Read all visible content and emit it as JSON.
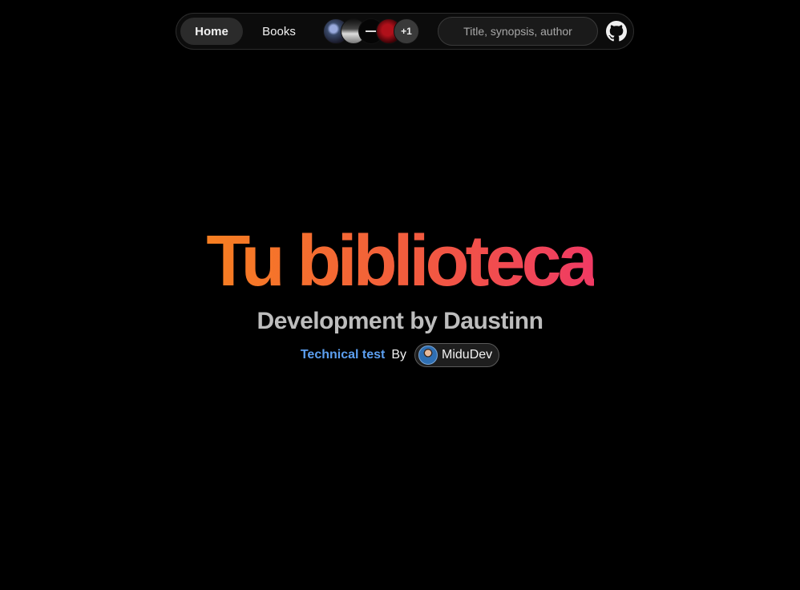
{
  "nav": {
    "home_label": "Home",
    "books_label": "Books",
    "covers": [
      {
        "icon": "book-cover-1"
      },
      {
        "icon": "book-cover-2"
      },
      {
        "icon": "book-cover-3"
      },
      {
        "icon": "book-cover-4"
      }
    ],
    "more_count": "+1",
    "search_placeholder": "Title, synopsis, author",
    "github_icon": "github-icon"
  },
  "hero": {
    "title": "Tu biblioteca",
    "subtitle": "Development by Daustinn",
    "credit_prefix": "Technical test",
    "credit_by": "By",
    "author": "MiduDev"
  },
  "colors": {
    "title_gradient_start": "#f77f21",
    "title_gradient_end": "#f03a64",
    "link_blue": "#5c9ff0",
    "background": "#000000"
  }
}
